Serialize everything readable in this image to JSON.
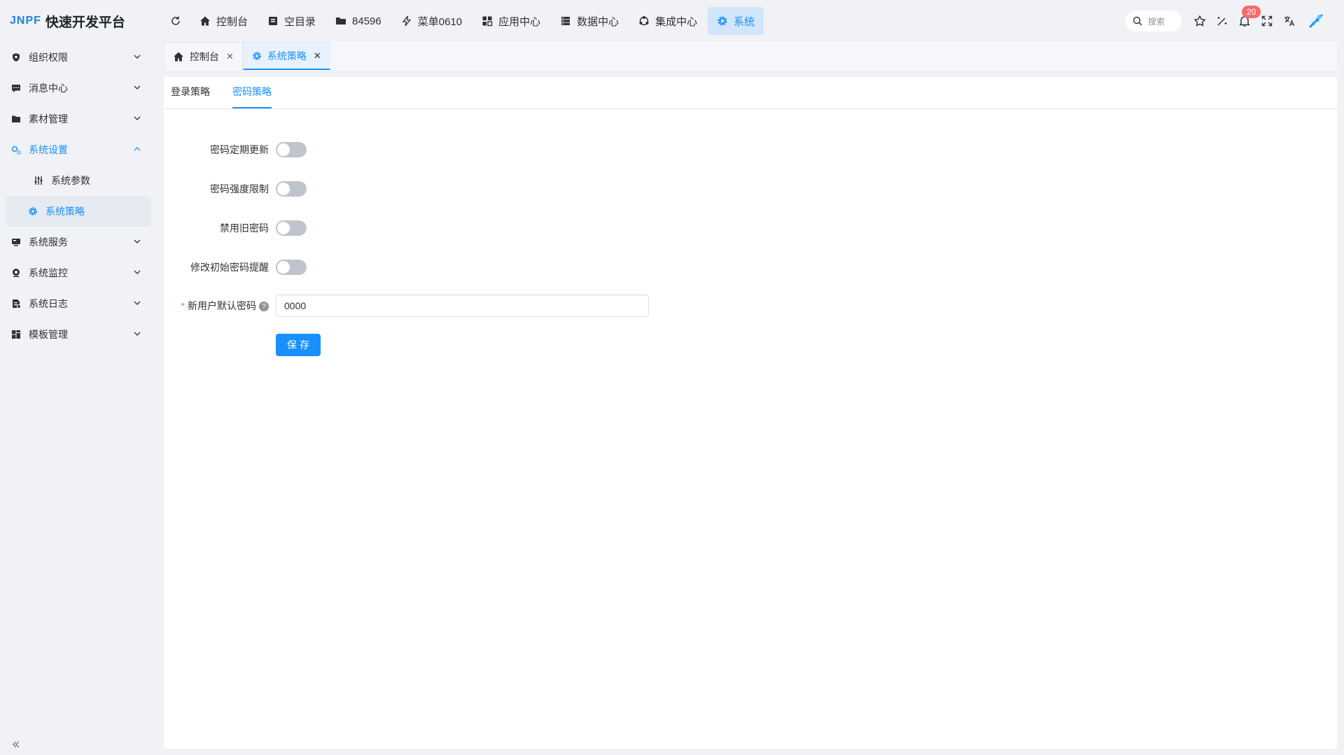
{
  "app": {
    "logo_mark_a": "JNPF",
    "title": "快速开发平台"
  },
  "topnav": [
    {
      "label": "控制台",
      "icon": "home-icon"
    },
    {
      "label": "空目录",
      "icon": "book-icon"
    },
    {
      "label": "84596",
      "icon": "folder-icon"
    },
    {
      "label": "菜单0610",
      "icon": "flash-icon"
    },
    {
      "label": "应用中心",
      "icon": "apps-icon"
    },
    {
      "label": "数据中心",
      "icon": "database-icon"
    },
    {
      "label": "集成中心",
      "icon": "integration-icon"
    },
    {
      "label": "系统",
      "icon": "gear-icon",
      "active": true
    }
  ],
  "header_right": {
    "search_placeholder": "搜索",
    "notification_count": "20"
  },
  "sidebar": {
    "items": [
      {
        "label": "组织权限",
        "icon": "shield-icon"
      },
      {
        "label": "消息中心",
        "icon": "message-icon"
      },
      {
        "label": "素材管理",
        "icon": "folder-icon"
      },
      {
        "label": "系统设置",
        "icon": "gears-icon",
        "open": true,
        "children": [
          {
            "label": "系统参数",
            "icon": "sliders-icon"
          },
          {
            "label": "系统策略",
            "icon": "gear-icon",
            "active": true
          }
        ]
      },
      {
        "label": "系统服务",
        "icon": "server-icon"
      },
      {
        "label": "系统监控",
        "icon": "monitor-icon"
      },
      {
        "label": "系统日志",
        "icon": "log-icon"
      },
      {
        "label": "模板管理",
        "icon": "template-icon"
      }
    ]
  },
  "tabs": [
    {
      "label": "控制台",
      "icon": "home-icon"
    },
    {
      "label": "系统策略",
      "icon": "gear-icon",
      "active": true
    }
  ],
  "subtabs": [
    {
      "label": "登录策略"
    },
    {
      "label": "密码策略",
      "active": true
    }
  ],
  "form": {
    "fields": [
      {
        "label": "密码定期更新",
        "type": "switch",
        "value": false
      },
      {
        "label": "密码强度限制",
        "type": "switch",
        "value": false
      },
      {
        "label": "禁用旧密码",
        "type": "switch",
        "value": false
      },
      {
        "label": "修改初始密码提醒",
        "type": "switch",
        "value": false
      }
    ],
    "default_password": {
      "label": "新用户默认密码",
      "required_mark": "*",
      "help_glyph": "?",
      "value": "0000"
    },
    "save_label": "保存"
  },
  "colors": {
    "accent": "#1890ff",
    "active_nav_bg": "#d2e6fb",
    "badge": "#f56c6c",
    "switch_off": "#c0c4cc"
  }
}
